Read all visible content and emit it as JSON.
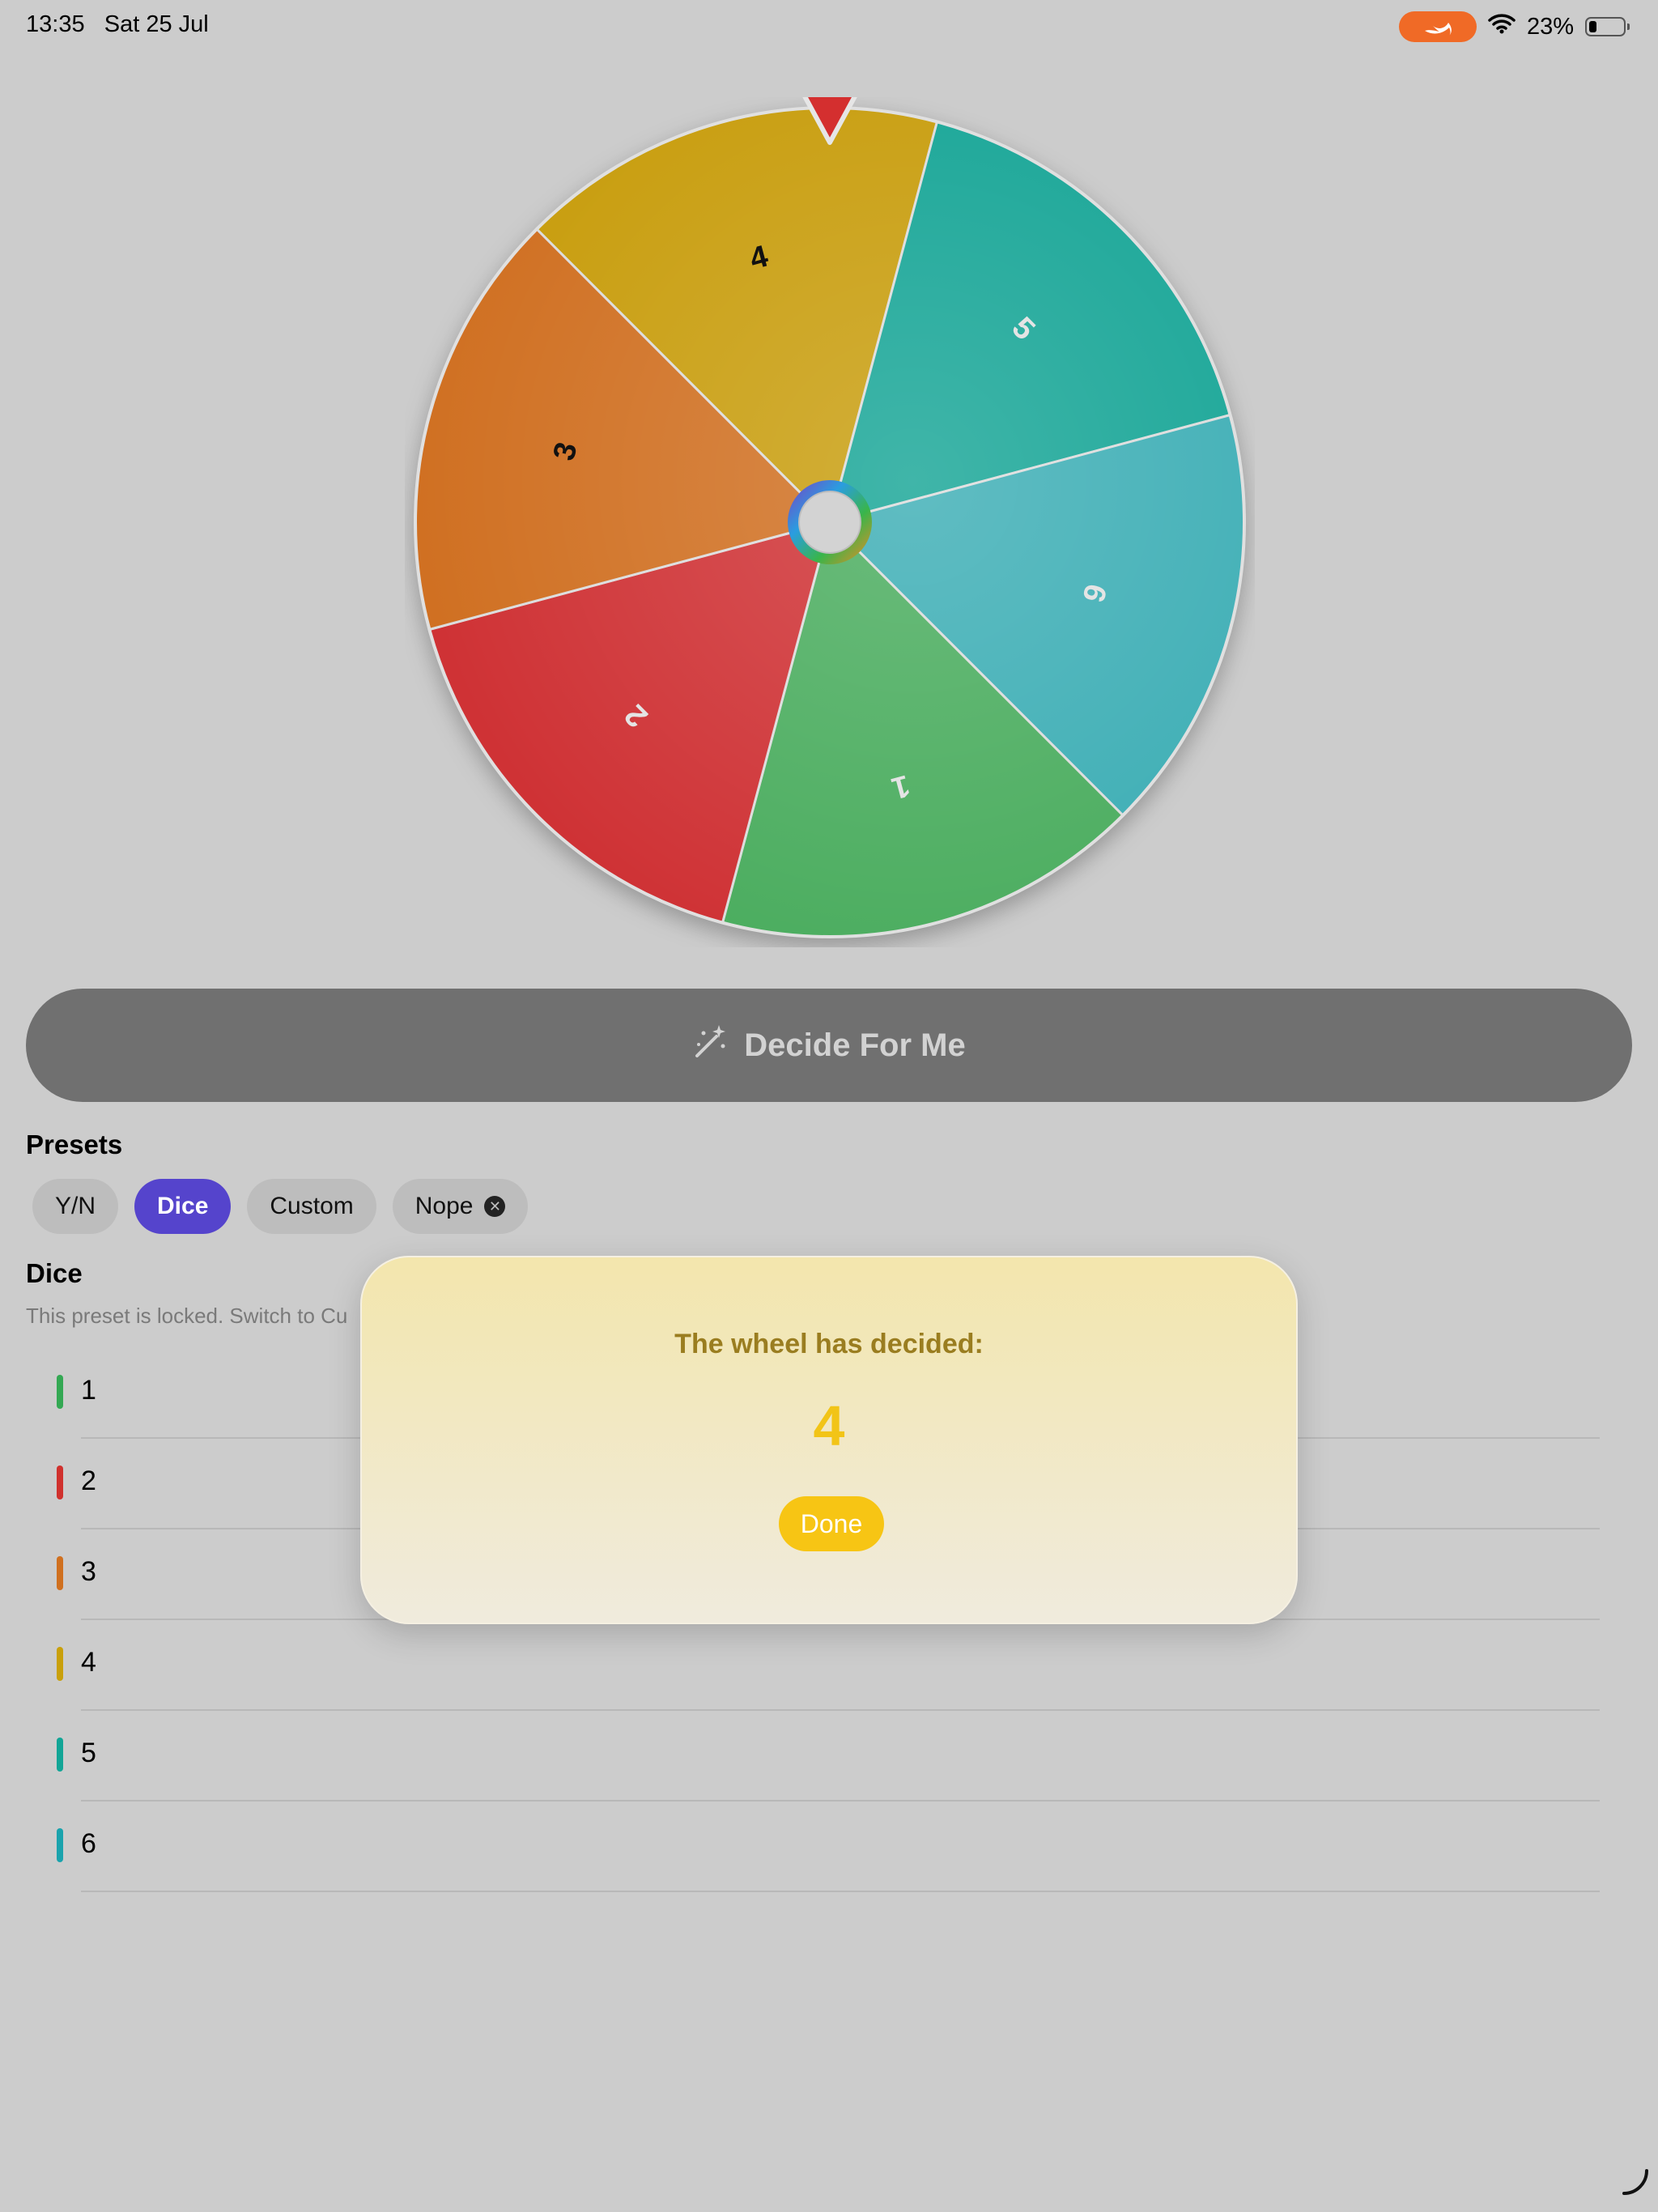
{
  "status_bar": {
    "time": "13:35",
    "date": "Sat 25 Jul",
    "battery_text": "23%",
    "battery_level": 0.23
  },
  "wheel": {
    "pointer_color": "#d42f2f",
    "segments": [
      {
        "label": "4",
        "color": "#c89d0a"
      },
      {
        "label": "5",
        "color": "#14a596"
      },
      {
        "label": "6",
        "color": "#3caeb5"
      },
      {
        "label": "1",
        "color": "#4cad5e"
      },
      {
        "label": "2",
        "color": "#cf3136"
      },
      {
        "label": "3",
        "color": "#d06f22"
      }
    ]
  },
  "decide_button": {
    "label": "Decide For Me",
    "icon": "magic-wand-icon"
  },
  "presets": {
    "title": "Presets",
    "chips": [
      {
        "label": "Y/N",
        "active": false
      },
      {
        "label": "Dice",
        "active": true
      },
      {
        "label": "Custom",
        "active": false
      },
      {
        "label": "Nope",
        "active": false,
        "removable": true
      }
    ]
  },
  "current_preset": {
    "title": "Dice",
    "note": "This preset is locked. Switch to Cu"
  },
  "options": [
    {
      "label": "1",
      "color": "#34a853"
    },
    {
      "label": "2",
      "color": "#d0312d"
    },
    {
      "label": "3",
      "color": "#d0701f"
    },
    {
      "label": "4",
      "color": "#c9a00b"
    },
    {
      "label": "5",
      "color": "#12a596"
    },
    {
      "label": "6",
      "color": "#1aa3ad"
    }
  ],
  "result_modal": {
    "title": "The wheel has decided:",
    "result": "4",
    "done_label": "Done"
  }
}
